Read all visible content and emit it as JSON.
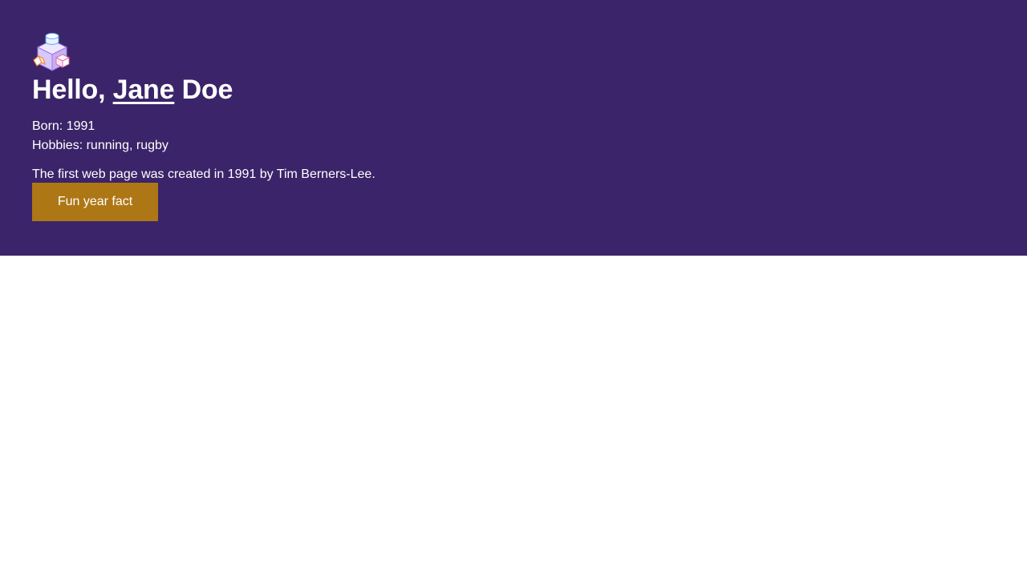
{
  "profile": {
    "greeting_prefix": "Hello, ",
    "first_name": "Jane",
    "last_name": " Doe",
    "born_label": "Born: ",
    "born_year": "1991",
    "hobbies_label": "Hobbies: ",
    "hobbies": "running, rugby"
  },
  "fact": {
    "text": "The first web page was created in 1991 by Tim Berners-Lee.",
    "button_label": "Fun year fact"
  },
  "colors": {
    "hero_background": "#3b2469",
    "button_background": "#ae7716",
    "text": "#ffffff"
  },
  "icons": {
    "logo": "isometric-blocks-icon"
  }
}
